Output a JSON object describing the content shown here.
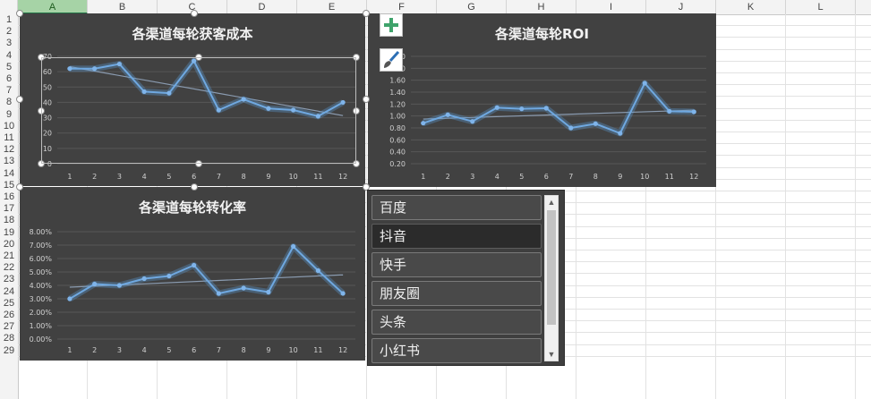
{
  "columns": [
    "A",
    "B",
    "C",
    "D",
    "E",
    "F",
    "G",
    "H",
    "I",
    "J",
    "K",
    "L"
  ],
  "selected_column": "A",
  "rows": [
    "1",
    "2",
    "3",
    "4",
    "5",
    "6",
    "7",
    "8",
    "9",
    "10",
    "11",
    "12",
    "13",
    "14",
    "15",
    "16",
    "17",
    "18",
    "19",
    "20",
    "21",
    "22",
    "23",
    "24",
    "25",
    "26",
    "27",
    "28",
    "29"
  ],
  "chart_data": [
    {
      "type": "line",
      "title": "各渠道每轮获客成本",
      "categories": [
        "1",
        "2",
        "3",
        "4",
        "5",
        "6",
        "7",
        "8",
        "9",
        "10",
        "11",
        "12"
      ],
      "values": [
        62,
        62,
        65,
        47,
        46,
        67,
        35,
        42,
        36,
        35,
        31,
        40
      ],
      "trendline": true,
      "y_ticks": [
        "0",
        "10",
        "20",
        "30",
        "40",
        "50",
        "60",
        "70"
      ],
      "ylim": [
        0,
        70
      ],
      "grid": true
    },
    {
      "type": "line",
      "title": "各渠道每轮ROI",
      "categories": [
        "1",
        "2",
        "3",
        "4",
        "5",
        "6",
        "7",
        "8",
        "9",
        "10",
        "11",
        "12"
      ],
      "values": [
        0.88,
        1.02,
        0.91,
        1.14,
        1.12,
        1.13,
        0.8,
        0.87,
        0.71,
        1.55,
        1.08,
        1.07
      ],
      "trendline": true,
      "y_ticks": [
        "0.20",
        "0.40",
        "0.60",
        "0.80",
        "1.00",
        "1.20",
        "1.40",
        "1.60",
        "1.80",
        "2.00"
      ],
      "ylim": [
        0.2,
        2.0
      ],
      "grid": true
    },
    {
      "type": "line",
      "title": "各渠道每轮转化率",
      "categories": [
        "1",
        "2",
        "3",
        "4",
        "5",
        "6",
        "7",
        "8",
        "9",
        "10",
        "11",
        "12"
      ],
      "values": [
        3.0,
        4.1,
        4.0,
        4.5,
        4.7,
        5.5,
        3.4,
        3.8,
        3.5,
        6.9,
        5.1,
        3.4
      ],
      "trendline": true,
      "y_ticks": [
        "0.00%",
        "1.00%",
        "2.00%",
        "3.00%",
        "4.00%",
        "5.00%",
        "6.00%",
        "7.00%",
        "8.00%"
      ],
      "ylim": [
        0,
        8
      ],
      "grid": true
    }
  ],
  "chart_tools": {
    "add_element_icon": "plus-icon",
    "style_icon": "paintbrush-icon"
  },
  "slicer": {
    "items": [
      "百度",
      "抖音",
      "快手",
      "朋友圈",
      "头条",
      "小红书"
    ],
    "selected": "抖音"
  },
  "colors": {
    "chart_bg": "#414141",
    "series": "#5b9bd5",
    "selected_header": "#a6d3a6"
  }
}
